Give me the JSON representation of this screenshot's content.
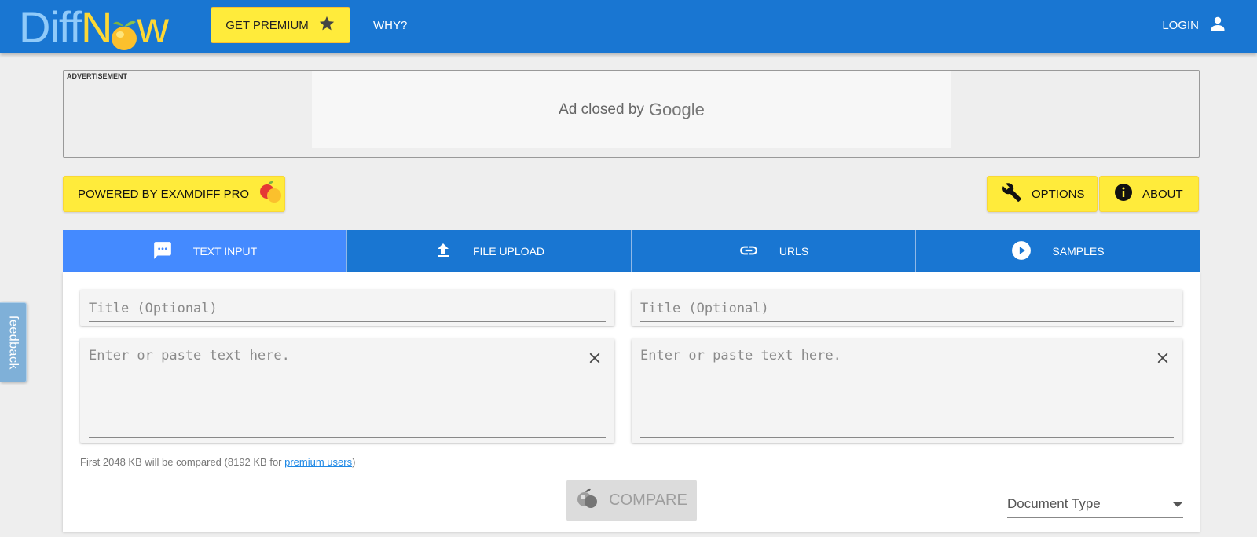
{
  "header": {
    "logo_diff": "Diff",
    "logo_n": "N",
    "logo_w": "w",
    "premium_label": "GET PREMIUM",
    "why_label": "WHY?",
    "login_label": "LOGIN"
  },
  "ad": {
    "label": "ADVERTISEMENT",
    "closed_text": "Ad closed by",
    "brand": "Google"
  },
  "actions": {
    "powered_label": "POWERED BY EXAMDIFF PRO",
    "options_label": "OPTIONS",
    "about_label": "ABOUT"
  },
  "tabs": [
    {
      "label": "TEXT INPUT",
      "icon": "message-icon",
      "active": true
    },
    {
      "label": "FILE UPLOAD",
      "icon": "upload-icon",
      "active": false
    },
    {
      "label": "URLS",
      "icon": "link-icon",
      "active": false
    },
    {
      "label": "SAMPLES",
      "icon": "play-circle-icon",
      "active": false
    }
  ],
  "editor": {
    "left_title_placeholder": "Title (Optional)",
    "right_title_placeholder": "Title (Optional)",
    "left_text_placeholder": "Enter or paste text here.",
    "right_text_placeholder": "Enter or paste text here.",
    "limit_prefix": "First 2048 KB will be compared (8192 KB for ",
    "limit_link": "premium users",
    "limit_suffix": ")",
    "compare_label": "COMPARE",
    "doctype_label": "Document Type"
  },
  "feedback": {
    "label": "feedback"
  },
  "colors": {
    "primary": "#1976d2",
    "active_tab": "#448aff",
    "accent_yellow": "#ffeb3b"
  }
}
